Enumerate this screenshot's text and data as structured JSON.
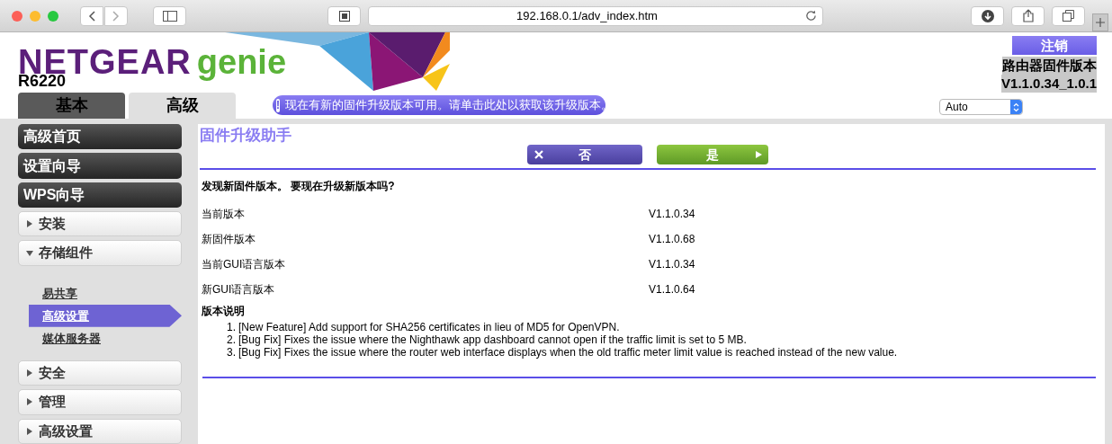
{
  "browser": {
    "url": "192.168.0.1/adv_index.htm"
  },
  "header": {
    "brand": "NETGEAR",
    "brand_sub": "genie",
    "model": "R6220",
    "logout": "注销",
    "firmware_label": "路由器固件版本",
    "firmware_version": "V1.1.0.34_1.0.1",
    "language": "Auto",
    "alert": "现在有新的固件升级版本可用。请单击此处以获取该升级版本。",
    "alert_icon": "!"
  },
  "tabs": [
    {
      "label": "基本",
      "selected": false
    },
    {
      "label": "高级",
      "selected": true
    }
  ],
  "sidebar": {
    "items": [
      {
        "kind": "main",
        "label": "高级首页"
      },
      {
        "kind": "main",
        "label": "设置向导"
      },
      {
        "kind": "main",
        "label": "WPS向导"
      },
      {
        "kind": "section",
        "label": "安装",
        "expanded": false
      },
      {
        "kind": "section",
        "label": "存储组件",
        "expanded": true,
        "children": [
          {
            "label": "易共享",
            "selected": false
          },
          {
            "label": "高级设置",
            "selected": true
          },
          {
            "label": "媒体服务器",
            "selected": false
          }
        ]
      },
      {
        "kind": "section",
        "label": "安全",
        "expanded": false
      },
      {
        "kind": "section",
        "label": "管理",
        "expanded": false
      },
      {
        "kind": "section",
        "label": "高级设置",
        "expanded": false
      }
    ]
  },
  "content": {
    "title": "固件升级助手",
    "buttons": [
      {
        "kind": "cancel",
        "label": "否"
      },
      {
        "kind": "apply",
        "label": "是"
      }
    ],
    "question": "发现新固件版本。 要现在升级新版本吗?",
    "rows": [
      {
        "label": "当前版本",
        "value": "V1.1.0.34"
      },
      {
        "label": "新固件版本",
        "value": "V1.1.0.68"
      },
      {
        "label": "当前GUI语言版本",
        "value": "V1.1.0.34"
      },
      {
        "label": "新GUI语言版本",
        "value": "V1.1.0.64"
      }
    ],
    "notes_title": "版本说明",
    "notes": [
      {
        "number": "1.",
        "text": "[New Feature] Add support for SHA256 certificates in lieu of MD5 for OpenVPN."
      },
      {
        "number": "2.",
        "text": "[Bug Fix] Fixes the issue where the Nighthawk app dashboard cannot open if the traffic limit is set to 5 MB."
      },
      {
        "number": "3.",
        "text": "[Bug Fix] Fixes the issue where the router web interface displays when the old traffic meter limit value is reached instead of the new value."
      }
    ]
  }
}
